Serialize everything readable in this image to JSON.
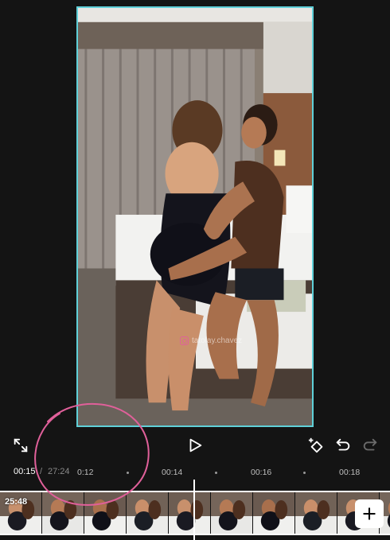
{
  "preview": {
    "watermark_text": "tatolay.chavez",
    "border_color": "#5fd0d8"
  },
  "toolbar": {
    "fullscreen_icon": "fullscreen-icon",
    "play_icon": "play-icon",
    "keyframe_icon": "keyframe-add-icon",
    "undo_icon": "undo-icon",
    "redo_icon": "redo-icon"
  },
  "ruler": {
    "current_time": "00:15",
    "separator": "/",
    "total_time": "27:24",
    "ticks": [
      "0:12",
      "00:14",
      "00:16",
      "00:18"
    ]
  },
  "timeline": {
    "clip_duration": "25:48",
    "add_clip_icon": "plus-icon"
  },
  "colors": {
    "background": "#141414",
    "annotation_circle": "#e0609a"
  }
}
